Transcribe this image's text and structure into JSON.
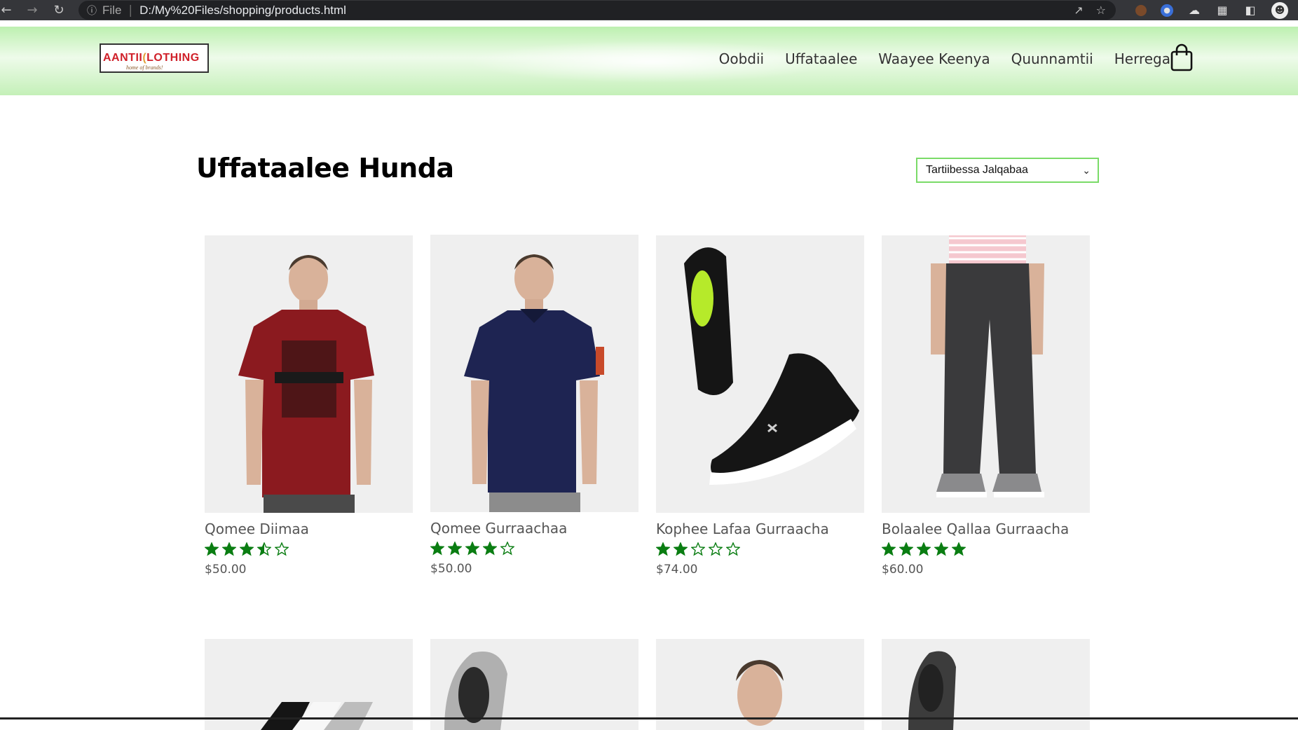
{
  "browser": {
    "scheme": "File",
    "url": "D:/My%20Files/shopping/products.html"
  },
  "header": {
    "logo_main": "AANTII",
    "logo_second": "LOTHING",
    "logo_tagline": "home of brands!",
    "nav": [
      "Oobdii",
      "Uffataalee",
      "Waayee Keenya",
      "Quunnamtii",
      "Herrega"
    ]
  },
  "main": {
    "title": "Uffataalee Hunda",
    "sort_selected": "Tartiibessa Jalqabaa"
  },
  "products": [
    {
      "name": "Qomee Diimaa",
      "price": "$50.00",
      "rating": 3.5,
      "image": "red-tshirt"
    },
    {
      "name": "Qomee Gurraachaa",
      "price": "$50.00",
      "rating": 4,
      "image": "navy-polo"
    },
    {
      "name": "Kophee Lafaa Gurraacha",
      "price": "$74.00",
      "rating": 2,
      "image": "black-sneakers"
    },
    {
      "name": "Bolaalee Qallaa Gurraacha",
      "price": "$60.00",
      "rating": 5,
      "image": "grey-joggers"
    }
  ],
  "products_row2": [
    {
      "image": "socks"
    },
    {
      "image": "grey-shoe"
    },
    {
      "image": "model"
    },
    {
      "image": "dark-shoe"
    }
  ],
  "colors": {
    "star": "#0a7d12",
    "header_green": "#bdf0b0",
    "sort_border": "#7adb68"
  }
}
